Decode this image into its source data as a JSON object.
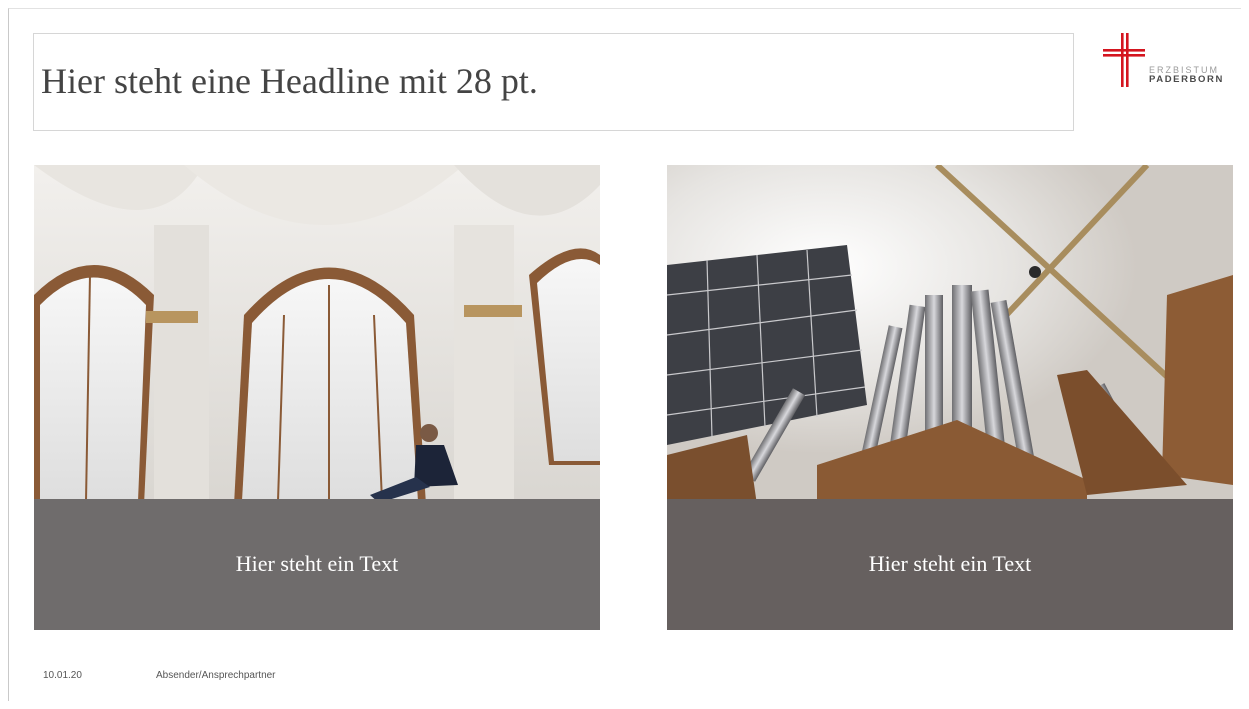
{
  "headline": "Hier steht eine Headline mit 28 pt.",
  "logo": {
    "line1": "ERZBISTUM",
    "line2": "PADERBORN",
    "cross_color": "#d4151f"
  },
  "cards": [
    {
      "caption": "Hier steht ein Text",
      "image": "church-interior-man-on-ledge"
    },
    {
      "caption": "Hier steht ein Text",
      "image": "organ-pipes-from-below"
    }
  ],
  "footer": {
    "date": "10.01.20",
    "sender": "Absender/Ansprechpartner"
  },
  "colors": {
    "caption_band": "#6f6c6c",
    "headline_text": "#444444"
  }
}
